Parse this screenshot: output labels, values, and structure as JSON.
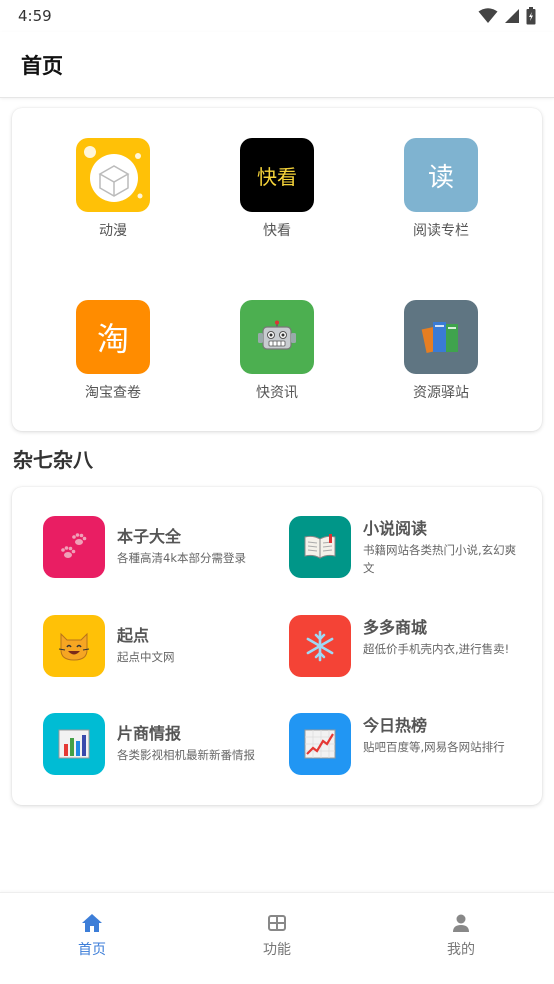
{
  "status_bar": {
    "time": "4:59"
  },
  "app_bar": {
    "title": "首页"
  },
  "top_grid": [
    {
      "label": "动漫",
      "icon": "anime-box-icon",
      "bg": "#FFC107"
    },
    {
      "label": "快看",
      "icon_text": "快看",
      "bg": "#000000",
      "fg": "#F5D33A"
    },
    {
      "label": "阅读专栏",
      "icon_text": "读",
      "bg": "#7FB3D0",
      "fg": "#ffffff"
    },
    {
      "label": "淘宝查卷",
      "icon_text": "淘",
      "bg": "#FF8C00",
      "fg": "#ffffff"
    },
    {
      "label": "快资讯",
      "icon": "robot-icon",
      "bg": "#4CAF50"
    },
    {
      "label": "资源驿站",
      "icon": "books-icon",
      "bg": "#5F7582"
    }
  ],
  "section": {
    "title": "杂七杂八"
  },
  "list_items": [
    {
      "title": "本子大全",
      "desc": "各種高清4k本部分需登录",
      "icon": "paws-icon",
      "bg": "#E91E63"
    },
    {
      "title": "小说阅读",
      "desc": "书籍网站各类热门小说,玄幻爽文",
      "icon": "open-book-icon",
      "bg": "#009688"
    },
    {
      "title": "起点",
      "desc": "起点中文网",
      "icon": "cat-face-icon",
      "bg": "#FFC107"
    },
    {
      "title": "多多商城",
      "desc": "超低价手机壳内衣,进行售卖!",
      "icon": "snowflake-icon",
      "bg": "#F44336"
    },
    {
      "title": "片商情报",
      "desc": "各类影视相机最新新番情报",
      "icon": "bar-chart-icon",
      "bg": "#00BCD4"
    },
    {
      "title": "今日热榜",
      "desc": "贴吧百度等,网易各网站排行",
      "icon": "trend-chart-icon",
      "bg": "#2196F3"
    }
  ],
  "bottom_nav": [
    {
      "label": "首页",
      "icon": "home-icon",
      "active": true
    },
    {
      "label": "功能",
      "icon": "grid-icon",
      "active": false
    },
    {
      "label": "我的",
      "icon": "person-icon",
      "active": false
    }
  ]
}
